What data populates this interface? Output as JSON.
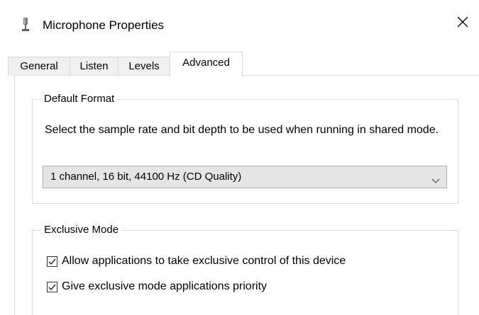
{
  "window": {
    "title": "Microphone Properties",
    "icon": "microphone-icon",
    "close_icon": "close-icon"
  },
  "tabs": [
    {
      "label": "General",
      "active": false
    },
    {
      "label": "Listen",
      "active": false
    },
    {
      "label": "Levels",
      "active": false
    },
    {
      "label": "Advanced",
      "active": true
    }
  ],
  "default_format": {
    "legend": "Default Format",
    "description": "Select the sample rate and bit depth to be used when running in shared mode.",
    "selected_value": "1 channel, 16 bit, 44100 Hz (CD Quality)",
    "dropdown_icon": "chevron-down-icon"
  },
  "exclusive_mode": {
    "legend": "Exclusive Mode",
    "options": [
      {
        "label": "Allow applications to take exclusive control of this device",
        "checked": true
      },
      {
        "label": "Give exclusive mode applications priority",
        "checked": true
      }
    ]
  }
}
